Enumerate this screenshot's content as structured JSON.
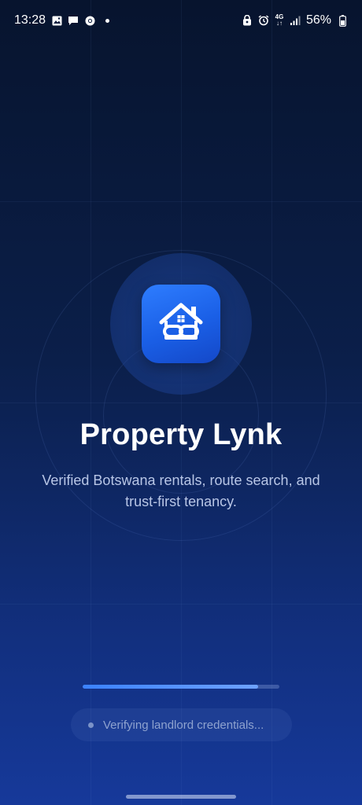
{
  "status_bar": {
    "time": "13:28",
    "battery_percent": "56%",
    "network": "4G",
    "left_icons": [
      "gallery-icon",
      "message-icon",
      "chrome-icon",
      "dot-icon"
    ],
    "right_icons": [
      "lock-notification-icon",
      "alarm-icon",
      "network-4g-icon",
      "signal-icon",
      "battery-icon"
    ]
  },
  "splash": {
    "app_name": "Property Lynk",
    "tagline": "Verified Botswana rentals, route search, and trust-first tenancy.",
    "logo_icon": "house-link-icon"
  },
  "loading": {
    "progress": 0.89,
    "status_text": "Verifying landlord credentials..."
  },
  "colors": {
    "background_top": "#07142e",
    "background_bottom": "#16399a",
    "accent": "#2e7dff",
    "progress_fill": "#3b82ff"
  }
}
